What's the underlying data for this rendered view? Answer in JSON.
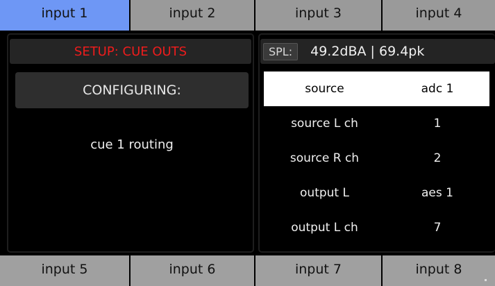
{
  "top_tabs": [
    {
      "label": "input 1",
      "active": true
    },
    {
      "label": "input 2",
      "active": false
    },
    {
      "label": "input 3",
      "active": false
    },
    {
      "label": "input 4",
      "active": false
    }
  ],
  "bottom_tabs": [
    {
      "label": "input 5"
    },
    {
      "label": "input 6"
    },
    {
      "label": "input 7"
    },
    {
      "label": "input 8"
    }
  ],
  "setup": {
    "title": "SETUP: CUE OUTS",
    "configuring_label": "CONFIGURING:",
    "routing_text": "cue 1 routing"
  },
  "spl": {
    "label": "SPL:",
    "value": "49.2dBA | 69.4pk"
  },
  "params": [
    {
      "name": "source",
      "value": "adc 1",
      "selected": true
    },
    {
      "name": "source L ch",
      "value": "1",
      "selected": false
    },
    {
      "name": "source R ch",
      "value": "2",
      "selected": false
    },
    {
      "name": "output L",
      "value": "aes 1",
      "selected": false
    },
    {
      "name": "output L ch",
      "value": "7",
      "selected": false
    }
  ],
  "colors": {
    "tab_active": "#6e97f5",
    "tab_inactive": "#9a9a9a",
    "setup_title": "#ee1c1c",
    "background": "#000000"
  }
}
